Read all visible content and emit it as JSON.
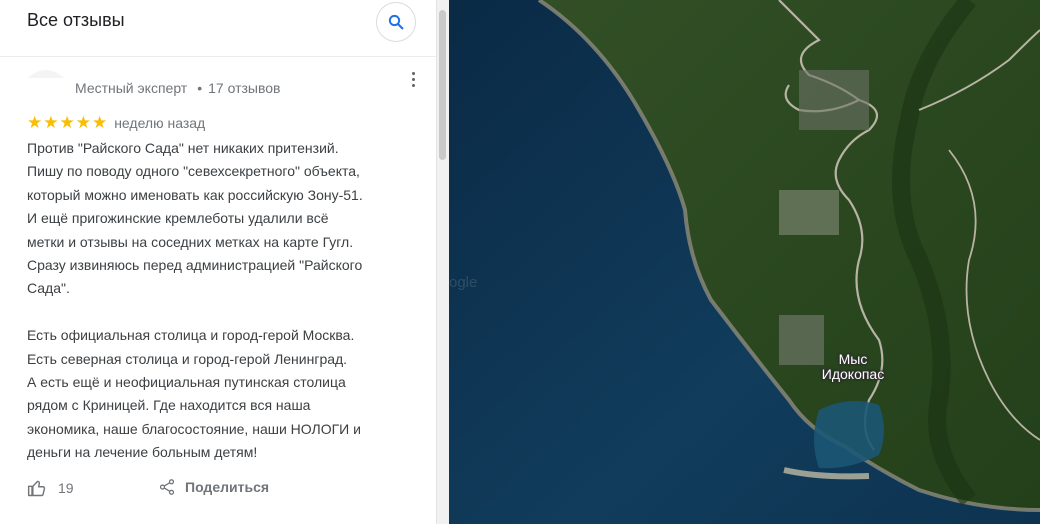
{
  "header": {
    "title": "Все отзывы",
    "search_icon": "search-icon"
  },
  "review": {
    "reviewer_type": "Местный эксперт",
    "review_count": "17 отзывов",
    "stars": "★★★★★",
    "rating": 5,
    "date": "неделю назад",
    "lines": [
      "Против \"Райского Сада\" нет никаких притензий.",
      "Пишу по поводу одного \"севехсекретного\" объекта,",
      "который можно именовать как российскую Зону-51.",
      "И ещё пригожинские кремлеботы удалили всё",
      "метки и отзывы на соседних метках на карте Гугл.",
      "Сразу извиняюсь перед администрацией \"Райского",
      "Сада\".",
      "",
      "Есть официальная столица и город-герой Москва.",
      "Есть северная столица и город-герой Ленинград.",
      "А есть ещё и неофициальная путинская столица",
      "рядом с Криницей. Где находится вся наша",
      "экономика, наше благосостояние, наши НОЛОГИ и",
      "деньги на лечение больным детям!"
    ],
    "likes": "19",
    "share_label": "Поделиться"
  },
  "map": {
    "label_line1": "Мыс",
    "label_line2": "Идокопас",
    "watermark": "ogle",
    "colors": {
      "sea_deep": "#0c2f4b",
      "sea": "#123f5e",
      "land": "#2d4d22",
      "land_dark": "#1f3a18",
      "road": "#b8b3a4"
    }
  },
  "colors": {
    "star": "#fbbc04",
    "text_secondary": "#70757a",
    "text_primary": "#3c4043",
    "accent": "#1a73e8"
  }
}
